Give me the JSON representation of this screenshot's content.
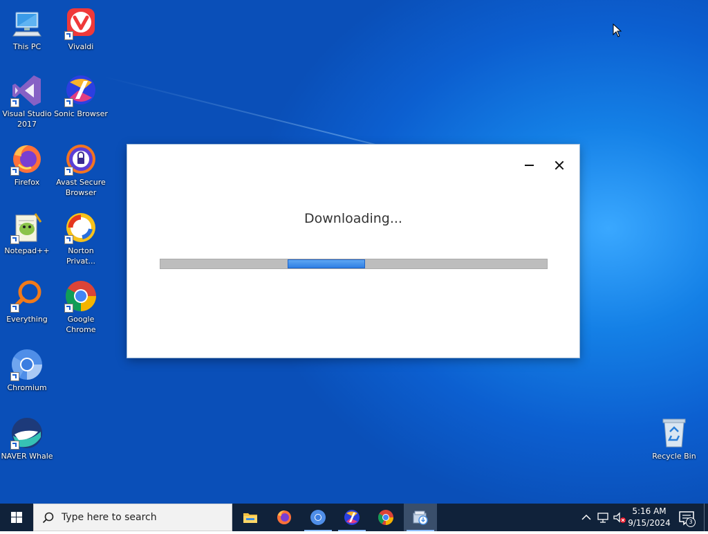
{
  "desktop": {
    "icons": [
      {
        "label": "This PC"
      },
      {
        "label": "Vivaldi"
      },
      {
        "label": "Visual Studio\n2017"
      },
      {
        "label": "Sonic Browser"
      },
      {
        "label": "Firefox"
      },
      {
        "label": "Avast Secure\nBrowser"
      },
      {
        "label": "Notepad++"
      },
      {
        "label": "Norton\nPrivat..."
      },
      {
        "label": "Everything"
      },
      {
        "label": "Google\nChrome"
      },
      {
        "label": "Chromium"
      },
      {
        "label": "NAVER Whale"
      },
      {
        "label": "Recycle Bin"
      }
    ]
  },
  "dialog": {
    "status": "Downloading...",
    "progress_fraction_start": 0.33,
    "progress_fraction_end": 0.53
  },
  "taskbar": {
    "search_placeholder": "Type here to search",
    "apps": [
      "file-explorer-icon",
      "firefox-icon",
      "chromium-icon",
      "sonic-browser-icon",
      "chrome-icon",
      "installer-icon"
    ],
    "active_app": "installer-icon",
    "clock": {
      "time": "5:16 AM",
      "date": "9/15/2024"
    },
    "notification_count": "3"
  },
  "colors": {
    "taskbar": "#10223a",
    "progress_fill": "#2f7fe4",
    "progress_track": "#bdbdbd",
    "desktop_blue": "#0c5fd0"
  }
}
